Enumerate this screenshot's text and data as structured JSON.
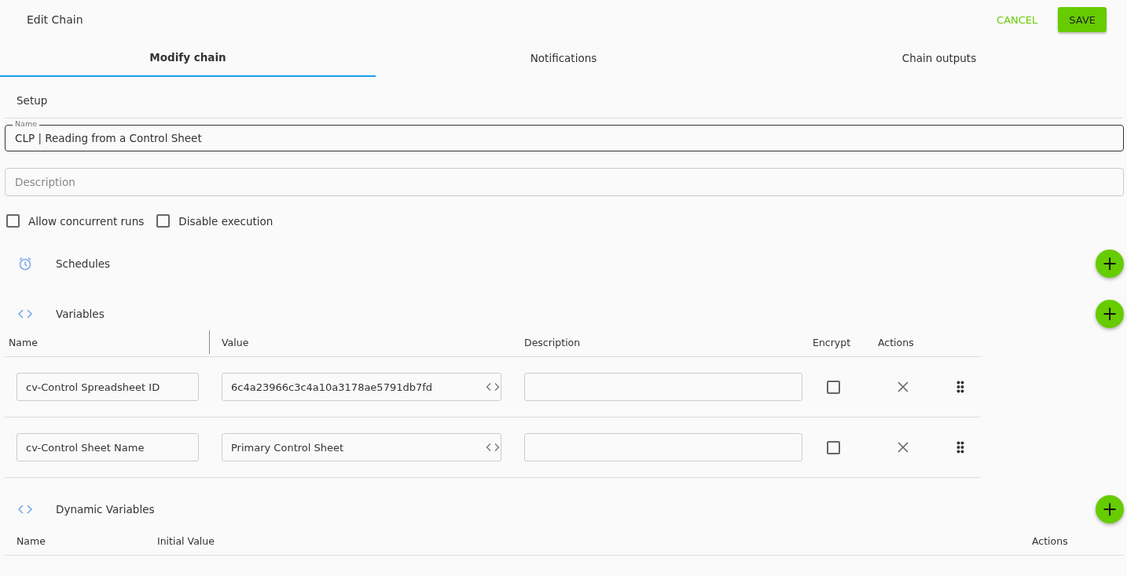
{
  "header": {
    "title": "Edit Chain",
    "cancel": "CANCEL",
    "save": "SAVE"
  },
  "tabs": [
    {
      "label": "Modify chain",
      "selected": true
    },
    {
      "label": "Notifications",
      "selected": false
    },
    {
      "label": "Chain outputs",
      "selected": false
    }
  ],
  "setup": {
    "title": "Setup",
    "name_label": "Name",
    "name_value": "CLP | Reading from a Control Sheet",
    "description_placeholder": "Description",
    "options": [
      {
        "label": "Allow concurrent runs",
        "checked": false
      },
      {
        "label": "Disable execution",
        "checked": false
      }
    ]
  },
  "schedules": {
    "title": "Schedules",
    "add": "+"
  },
  "variables": {
    "title": "Variables",
    "add": "+",
    "columns": [
      "Name",
      "Value",
      "Description",
      "Encrypt",
      "Actions"
    ],
    "rows": [
      {
        "name": "cv-Control Spreadsheet ID",
        "value": "6c4a23966c3c4a10a3178ae5791db7fd",
        "description": "",
        "encrypt": false
      },
      {
        "name": "cv-Control Sheet Name",
        "value": "Primary Control Sheet",
        "description": "",
        "encrypt": false
      }
    ]
  },
  "dynamic_variables": {
    "title": "Dynamic Variables",
    "add": "+",
    "columns": [
      "Name",
      "Initial Value",
      "Actions"
    ]
  }
}
